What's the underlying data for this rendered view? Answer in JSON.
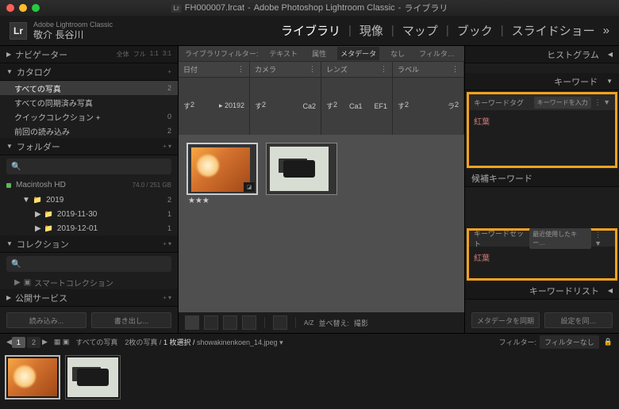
{
  "titlebar": {
    "filename": "FH000007.lrcat",
    "app": "Adobe Photoshop Lightroom Classic",
    "module": "ライブラリ"
  },
  "brand": {
    "small": "Adobe Lightroom Classic",
    "name": "敬介 長谷川"
  },
  "modules": {
    "library": "ライブラリ",
    "develop": "現像",
    "map": "マップ",
    "book": "ブック",
    "slideshow": "スライドショー",
    "more": "»"
  },
  "left": {
    "navigator": {
      "label": "ナビゲーター",
      "presets": [
        "全体",
        "フル",
        "1:1",
        "3:1"
      ]
    },
    "catalog": {
      "label": "カタログ",
      "items": [
        {
          "label": "すべての写真",
          "count": "2",
          "sel": true
        },
        {
          "label": "すべての同期済み写真"
        },
        {
          "label": "クイックコレクション +",
          "count": "0"
        },
        {
          "label": "前回の読み込み",
          "count": "2"
        }
      ]
    },
    "folders": {
      "label": "フォルダー",
      "vol": "Macintosh HD",
      "size": "74.0 / 251 GB",
      "year": "2019",
      "ycount": "2",
      "dates": [
        {
          "label": "2019-11-30",
          "count": "1"
        },
        {
          "label": "2019-12-01",
          "count": "1"
        }
      ]
    },
    "collections": {
      "label": "コレクション",
      "smart": "スマートコレクション"
    },
    "publish": {
      "label": "公開サービス"
    },
    "btn_import": "読み込み...",
    "btn_export": "書き出し..."
  },
  "filter": {
    "label": "ライブラリフィルター:",
    "text": "テキスト",
    "attr": "属性",
    "meta": "メタデータ",
    "none": "なし",
    "filtermenu": "フィルタ…"
  },
  "cols": {
    "date": "日付",
    "camera": "カメラ",
    "lens": "レンズ",
    "label": "ラベル",
    "date_rows": [
      {
        "k": "す",
        "v": "2"
      },
      {
        "k": "▸ 2019",
        "v": "2"
      }
    ],
    "cam_rows": [
      {
        "k": "す",
        "v": "2"
      },
      {
        "k": "Ca",
        "v": "2"
      }
    ],
    "lens_rows": [
      {
        "k": "す",
        "v": "2"
      },
      {
        "k": "Ca",
        "v": "1"
      },
      {
        "k": "EF",
        "v": "1"
      }
    ],
    "label_rows": [
      {
        "k": "す",
        "v": "2"
      },
      {
        "k": "ラ",
        "v": "2"
      }
    ]
  },
  "right": {
    "histogram": "ヒストグラム",
    "keywords": "キーワード",
    "kwtag": {
      "label": "キーワードタグ",
      "input": "キーワードを入力",
      "value": "紅葉"
    },
    "suggest": "候補キーワード",
    "kwset": {
      "label": "キーワードセット",
      "input": "最近使用したキー…",
      "value": "紅葉"
    },
    "kwlist": "キーワードリスト",
    "metareset": "メタデータを同期",
    "setdefault": "設定を同…"
  },
  "toolbar": {
    "sort": "並べ替え:",
    "sortval": "撮影",
    "ratio": "A/Z"
  },
  "status": {
    "path": "すべての写真　2枚の写真 /",
    "sel": "1 枚選択 /",
    "file": "showakinenkoen_14.jpeg",
    "filter": "フィルター:",
    "filterval": "フィルターなし"
  }
}
